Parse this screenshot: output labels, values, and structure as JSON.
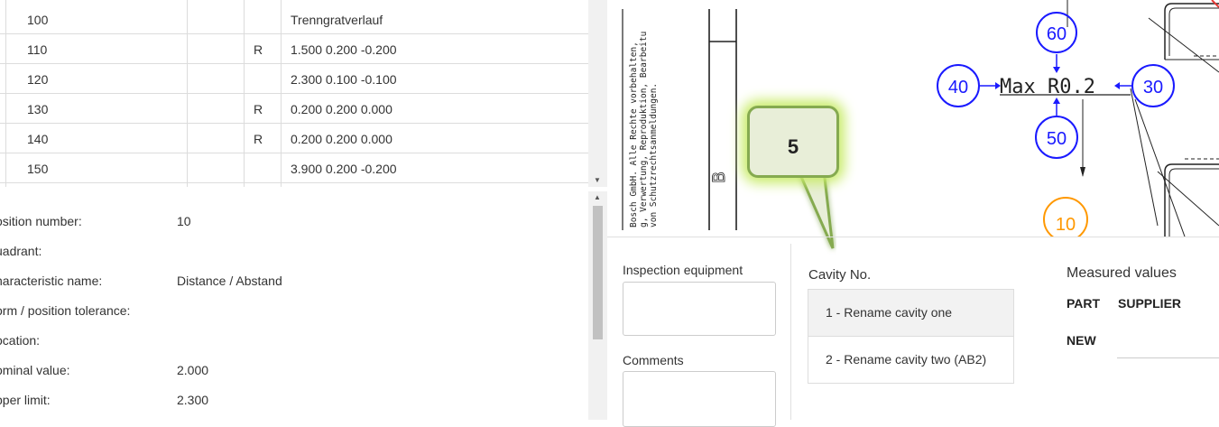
{
  "table": {
    "rows": [
      {
        "num": "100",
        "flag": "",
        "value": "Trenngratverlauf"
      },
      {
        "num": "110",
        "flag": "R",
        "value": "1.500  0.200  -0.200"
      },
      {
        "num": "120",
        "flag": "",
        "value": "2.300  0.100  -0.100"
      },
      {
        "num": "130",
        "flag": "R",
        "value": "0.200  0.200  0.000"
      },
      {
        "num": "140",
        "flag": "R",
        "value": "0.200  0.200  0.000"
      },
      {
        "num": "150",
        "flag": "",
        "value": "3.900  0.200  -0.200"
      }
    ]
  },
  "details": [
    {
      "label": "osition number:",
      "value": "10"
    },
    {
      "label": "uadrant:",
      "value": ""
    },
    {
      "label": "haracteristic name:",
      "value": "Distance / Abstand"
    },
    {
      "label": "orm / position tolerance:",
      "value": ""
    },
    {
      "label": "ocation:",
      "value": ""
    },
    {
      "label": "ominal value:",
      "value": "2.000"
    },
    {
      "label": "pper limit:",
      "value": "2.300"
    }
  ],
  "drawing": {
    "copyright": [
      "Bosch GmbH. Alle Rechte vorbehalten,",
      "g, Verwertung, Reproduktion, Bearbeitu",
      "von Schutzrechtsanmeldungen."
    ],
    "letter": "B",
    "balloons": {
      "b60": "60",
      "b40": "40",
      "b30": "30",
      "b50": "50",
      "b10": "10"
    },
    "dimension": "Max  R0.2",
    "callout": "5",
    "colors": {
      "balloon": "#1a1aff",
      "balloon_orange": "#ff9800",
      "callout_border": "#85aa50",
      "callout_glow": "#c9ec6a"
    }
  },
  "bottom": {
    "inspection_label": "Inspection equipment",
    "comments_label": "Comments",
    "cavity_label": "Cavity No.",
    "cavities": [
      "1 - Rename cavity one",
      "2 - Rename cavity two (AB2)"
    ],
    "measured_label": "Measured values",
    "part_label": "PART",
    "supplier_label": "SUPPLIER",
    "new_label": "NEW"
  }
}
